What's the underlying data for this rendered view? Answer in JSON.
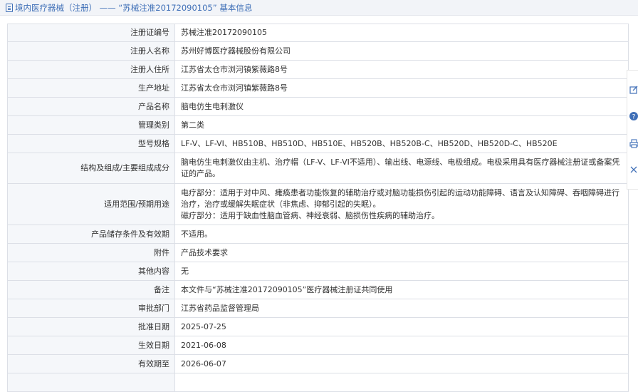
{
  "header": {
    "title": "境内医疗器械（注册） —— “苏械注准20172090105” 基本信息",
    "icon": "document-icon"
  },
  "rows": [
    {
      "label": "注册证编号",
      "value": "苏械注准20172090105"
    },
    {
      "label": "注册人名称",
      "value": "苏州好博医疗器械股份有限公司"
    },
    {
      "label": "注册人住所",
      "value": "江苏省太仓市浏河镇紫薇路8号"
    },
    {
      "label": "生产地址",
      "value": "江苏省太仓市浏河镇紫薇路8号"
    },
    {
      "label": "产品名称",
      "value": "脑电仿生电刺激仪"
    },
    {
      "label": "管理类别",
      "value": "第二类"
    },
    {
      "label": "型号规格",
      "value": "LF-V、LF-VI、HB510B、HB510D、HB510E、HB520B、HB520B-C、HB520D、HB520D-C、HB520E"
    },
    {
      "label": "结构及组成/主要组成成分",
      "value": "脑电仿生电刺激仪由主机、治疗帽（LF-V、LF-VI不适用）、输出线、电源线、电极组成。电极采用具有医疗器械注册证或备案凭证的产品。"
    },
    {
      "label": "适用范围/预期用途",
      "value": "电疗部分：适用于对中风、瘫痪患者功能恢复的辅助治疗或对脑功能损伤引起的运动功能障碍、语言及认知障碍、吞咽障碍进行治疗，治疗或缓解失眠症状（非焦虑、抑郁引起的失眠）。",
      "value2": "磁疗部分：适用于缺血性脑血管病、神经衰弱、脑损伤性疾病的辅助治疗。"
    },
    {
      "label": "产品储存条件及有效期",
      "value": "不适用。"
    },
    {
      "label": "附件",
      "value": "产品技术要求"
    },
    {
      "label": "其他内容",
      "value": "无"
    },
    {
      "label": "备注",
      "value": "本文件与“苏械注准20172090105”医疗器械注册证共同使用"
    },
    {
      "label": "审批部门",
      "value": "江苏省药品监督管理局"
    },
    {
      "label": "批准日期",
      "value": "2025-07-25"
    },
    {
      "label": "生效日期",
      "value": "2021-06-08"
    },
    {
      "label": "有效期至",
      "value": "2026-06-07"
    },
    {
      "label": "",
      "value": ""
    }
  ],
  "side_tools": [
    "edit-icon",
    "help-icon",
    "print-icon",
    "close-icon"
  ],
  "colors": {
    "title": "#3f6fb7",
    "label_bg": "#f5f7fa",
    "border": "#dcdfe6",
    "tool": "#3f6fb7"
  }
}
